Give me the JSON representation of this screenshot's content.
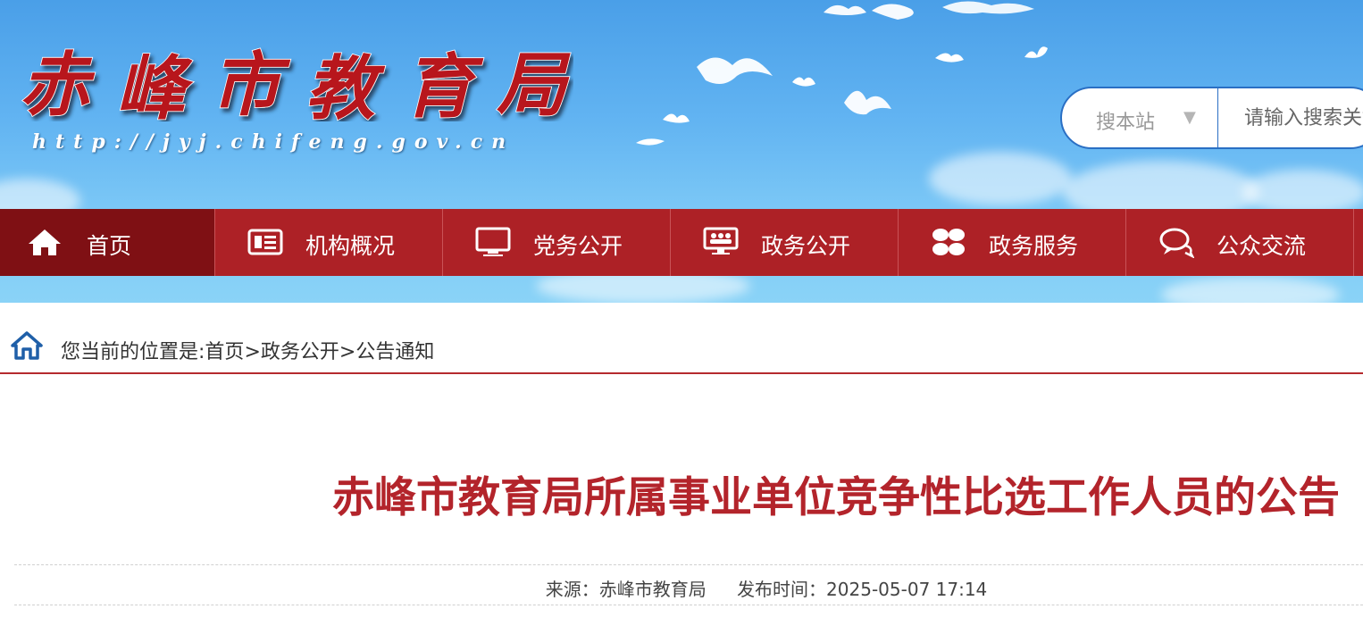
{
  "header": {
    "logo_text": "赤峰市教育局",
    "site_url": "http://jyj.chifeng.gov.cn"
  },
  "search": {
    "scope_label": "搜本站",
    "arrow": "▼",
    "placeholder": "请输入搜索关键字"
  },
  "nav": {
    "items": [
      {
        "label": "首页",
        "icon": "home-icon",
        "active": true
      },
      {
        "label": "机构概况",
        "icon": "newspaper-icon"
      },
      {
        "label": "党务公开",
        "icon": "monitor-icon"
      },
      {
        "label": "政务公开",
        "icon": "meeting-icon"
      },
      {
        "label": "政务服务",
        "icon": "grid-icon"
      },
      {
        "label": "公众交流",
        "icon": "chat-icon"
      }
    ]
  },
  "breadcrumb": {
    "prefix": "您当前的位置是:",
    "items": [
      "首页",
      "政务公开",
      "公告通知"
    ],
    "separator": ">"
  },
  "article": {
    "title": "赤峰市教育局所属事业单位竞争性比选工作人员的公告",
    "source": "来源：赤峰市教育局",
    "publish_time": "发布时间：2025-05-07 17:14"
  },
  "colors": {
    "nav_bg": "#ad2126",
    "nav_active": "#7f1014",
    "title": "#b3242b",
    "search_border": "#2a6fc4"
  }
}
